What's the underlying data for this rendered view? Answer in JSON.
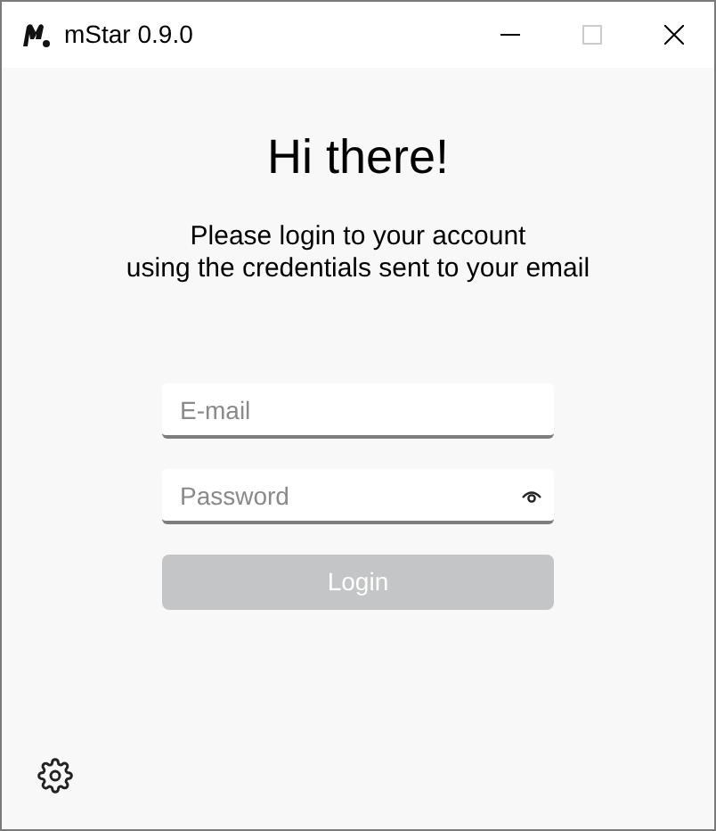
{
  "window": {
    "title": "mStar 0.9.0"
  },
  "heading": "Hi there!",
  "message": [
    "Please login to your account",
    "using the credentials sent to your email"
  ],
  "email": {
    "placeholder": "E-mail"
  },
  "password": {
    "placeholder": "Password"
  },
  "login_button": {
    "label": "Login",
    "disabled": true
  }
}
